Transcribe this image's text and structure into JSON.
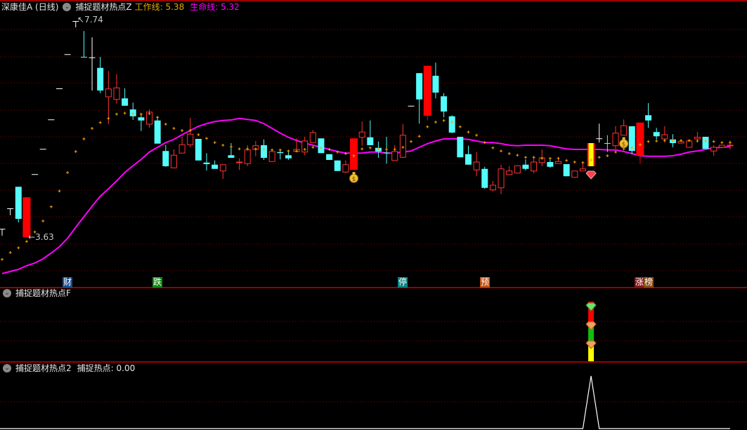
{
  "header": {
    "stock": "深康佳A (日线)",
    "indicator": "捕捉题材热点Z",
    "work_line_label": "工作线: 5.38",
    "life_line_label": "生命线: 5.32"
  },
  "panel2": {
    "title": "捕捉题材热点F"
  },
  "panel3": {
    "title": "捕捉题材热点2",
    "value_label": "捕捉热点: 0.00"
  },
  "annotations": {
    "high": "7.74",
    "low": "3.63",
    "high_arrow": "↖",
    "low_arrow": "←"
  },
  "signals": [
    {
      "text": "财",
      "color": "#1a4f8f"
    },
    {
      "text": "跌",
      "color": "#0f8a12"
    },
    {
      "text": "停",
      "color": "#0f8080"
    },
    {
      "text": "预",
      "color": "#c24f12"
    },
    {
      "text": "涨",
      "color": "#8a1414"
    },
    {
      "text": "榜",
      "color": "#8a4a14"
    }
  ],
  "colors": {
    "up": "#ff3232",
    "down": "#54fcfc",
    "flat": "#ffffff",
    "work_line": "#ffa500",
    "life_line": "#ff00ff",
    "grid": "#8b0000",
    "divider": "#d00000"
  },
  "icons": {
    "money_bag": "money-bag-icon",
    "diamond": "diamond-icon"
  },
  "chart_data": {
    "type": "candlestick",
    "title": "深康佳A (日线)",
    "ylim": [
      2.9,
      8.1
    ],
    "candles_ohlc": [
      [
        3.79,
        3.79,
        3.66,
        3.79
      ],
      [
        4.18,
        4.18,
        4.05,
        4.18
      ],
      [
        4.59,
        4.59,
        3.91,
        3.98
      ],
      [
        3.63,
        4.39,
        3.63,
        4.39
      ],
      [
        4.83,
        4.83,
        4.83,
        4.83
      ],
      [
        5.31,
        5.31,
        5.31,
        5.31
      ],
      [
        5.87,
        5.87,
        5.87,
        5.87
      ],
      [
        6.46,
        6.46,
        6.46,
        6.46
      ],
      [
        7.11,
        7.11,
        7.11,
        7.11
      ],
      [
        7.74,
        7.74,
        7.62,
        7.74
      ],
      [
        7.06,
        7.55,
        7.05,
        7.05
      ],
      [
        7.05,
        7.43,
        6.42,
        7.05
      ],
      [
        6.85,
        7.06,
        6.37,
        6.42
      ],
      [
        6.3,
        6.79,
        5.78,
        6.45
      ],
      [
        6.25,
        6.73,
        6.17,
        6.47
      ],
      [
        6.27,
        6.46,
        6.13,
        6.13
      ],
      [
        6.06,
        6.19,
        5.86,
        5.93
      ],
      [
        5.91,
        5.98,
        5.65,
        5.85
      ],
      [
        5.78,
        6.06,
        5.71,
        6.01
      ],
      [
        5.85,
        5.93,
        5.41,
        5.41
      ],
      [
        5.27,
        5.38,
        4.97,
        4.98
      ],
      [
        4.95,
        5.3,
        4.95,
        5.19
      ],
      [
        5.23,
        5.54,
        5.23,
        5.39
      ],
      [
        5.39,
        5.9,
        5.34,
        5.59
      ],
      [
        5.5,
        5.5,
        5.09,
        5.09
      ],
      [
        5.05,
        5.23,
        4.9,
        5.02
      ],
      [
        5.01,
        5.09,
        4.93,
        4.93
      ],
      [
        4.89,
        5.01,
        4.74,
        5.01
      ],
      [
        5.19,
        5.42,
        5.14,
        5.14
      ],
      [
        5.05,
        5.13,
        4.91,
        5.06
      ],
      [
        5.03,
        5.38,
        4.98,
        5.29
      ],
      [
        5.3,
        5.46,
        5.17,
        5.37
      ],
      [
        5.38,
        5.49,
        5.1,
        5.14
      ],
      [
        5.07,
        5.26,
        5.07,
        5.26
      ],
      [
        5.25,
        5.3,
        5.11,
        5.23
      ],
      [
        5.19,
        5.27,
        5.1,
        5.13
      ],
      [
        5.26,
        5.51,
        5.25,
        5.3
      ],
      [
        5.25,
        5.54,
        5.19,
        5.46
      ],
      [
        5.43,
        5.67,
        5.43,
        5.62
      ],
      [
        5.51,
        5.51,
        5.23,
        5.23
      ],
      [
        5.21,
        5.21,
        5.1,
        5.1
      ],
      [
        5.09,
        5.09,
        4.89,
        4.89
      ],
      [
        4.87,
        5.09,
        4.85,
        5.01
      ],
      [
        4.91,
        5.51,
        4.91,
        5.51
      ],
      [
        5.53,
        5.83,
        5.37,
        5.63
      ],
      [
        5.53,
        5.85,
        5.38,
        5.38
      ],
      [
        5.33,
        5.45,
        5.14,
        5.26
      ],
      [
        5.24,
        5.54,
        5.03,
        5.23
      ],
      [
        5.09,
        5.38,
        5.09,
        5.26
      ],
      [
        5.15,
        5.78,
        5.14,
        5.57
      ],
      [
        6.13,
        6.13,
        6.13,
        6.13
      ],
      [
        6.75,
        6.75,
        5.79,
        6.25
      ],
      [
        5.94,
        6.89,
        5.85,
        6.89
      ],
      [
        6.7,
        6.95,
        6.27,
        6.38
      ],
      [
        6.31,
        6.37,
        5.91,
        6.02
      ],
      [
        5.93,
        5.95,
        5.61,
        5.62
      ],
      [
        5.54,
        5.54,
        5.15,
        5.15
      ],
      [
        5.21,
        5.37,
        5.01,
        5.01
      ],
      [
        4.91,
        5.25,
        4.79,
        5.06
      ],
      [
        4.93,
        4.97,
        4.55,
        4.57
      ],
      [
        4.53,
        4.7,
        4.5,
        4.62
      ],
      [
        4.57,
        5.01,
        4.45,
        4.93
      ],
      [
        4.82,
        4.98,
        4.81,
        4.89
      ],
      [
        4.85,
        4.99,
        4.85,
        4.99
      ],
      [
        5.01,
        5.11,
        4.9,
        4.93
      ],
      [
        4.89,
        5.15,
        4.85,
        5.06
      ],
      [
        5.05,
        5.3,
        4.98,
        5.14
      ],
      [
        5.06,
        5.11,
        4.95,
        4.97
      ],
      [
        5.03,
        5.14,
        5.03,
        5.07
      ],
      [
        5.02,
        5.02,
        4.79,
        4.79
      ],
      [
        4.77,
        4.89,
        4.77,
        4.89
      ],
      [
        4.89,
        5.06,
        4.89,
        4.93
      ],
      [
        4.98,
        5.42,
        4.98,
        5.42
      ],
      [
        5.51,
        5.79,
        5.43,
        5.51
      ],
      [
        5.42,
        5.57,
        5.25,
        5.41
      ],
      [
        5.37,
        5.74,
        5.31,
        5.61
      ],
      [
        5.57,
        5.87,
        5.57,
        5.75
      ],
      [
        5.74,
        5.74,
        5.21,
        5.27
      ],
      [
        5.18,
        5.81,
        5.03,
        5.81
      ],
      [
        5.95,
        6.18,
        5.71,
        5.85
      ],
      [
        5.63,
        5.71,
        5.49,
        5.55
      ],
      [
        5.5,
        5.74,
        5.43,
        5.58
      ],
      [
        5.49,
        5.59,
        5.34,
        5.42
      ],
      [
        5.42,
        5.45,
        5.42,
        5.45
      ],
      [
        5.34,
        5.46,
        5.34,
        5.46
      ],
      [
        5.5,
        5.63,
        5.43,
        5.53
      ],
      [
        5.54,
        5.54,
        5.31,
        5.31
      ],
      [
        5.27,
        5.38,
        5.18,
        5.34
      ],
      [
        5.34,
        5.38,
        5.34,
        5.38
      ],
      [
        5.37,
        5.47,
        5.3,
        5.38
      ]
    ],
    "filled_up_indices": [
      3,
      43,
      52,
      78
    ],
    "highlight_index": 72,
    "work_line": [
      3.21,
      3.34,
      3.43,
      3.55,
      3.73,
      3.94,
      4.21,
      4.51,
      4.86,
      5.26,
      5.5,
      5.7,
      5.81,
      5.89,
      5.97,
      5.99,
      5.98,
      5.97,
      5.98,
      5.91,
      5.78,
      5.7,
      5.66,
      5.66,
      5.58,
      5.51,
      5.43,
      5.38,
      5.35,
      5.31,
      5.31,
      5.31,
      5.3,
      5.29,
      5.29,
      5.27,
      5.27,
      5.3,
      5.34,
      5.33,
      5.3,
      5.25,
      5.22,
      5.18,
      5.31,
      5.33,
      5.31,
      5.3,
      5.3,
      5.34,
      5.45,
      5.55,
      5.73,
      5.82,
      5.85,
      5.82,
      5.73,
      5.63,
      5.57,
      5.43,
      5.33,
      5.27,
      5.22,
      5.19,
      5.15,
      5.15,
      5.13,
      5.13,
      5.13,
      5.09,
      5.06,
      5.05,
      5.1,
      5.15,
      5.18,
      5.25,
      5.31,
      5.33,
      5.39,
      5.45,
      5.46,
      5.47,
      5.47,
      5.47,
      5.47,
      5.46,
      5.46,
      5.45,
      5.43,
      5.43
    ],
    "life_line": [
      2.94,
      2.98,
      3.02,
      3.09,
      3.14,
      3.22,
      3.33,
      3.45,
      3.61,
      3.82,
      4.02,
      4.22,
      4.41,
      4.55,
      4.7,
      4.86,
      4.99,
      5.11,
      5.25,
      5.34,
      5.43,
      5.49,
      5.58,
      5.66,
      5.74,
      5.79,
      5.83,
      5.85,
      5.86,
      5.89,
      5.87,
      5.85,
      5.79,
      5.7,
      5.61,
      5.53,
      5.47,
      5.42,
      5.38,
      5.34,
      5.3,
      5.26,
      5.23,
      5.23,
      5.23,
      5.25,
      5.25,
      5.23,
      5.23,
      5.25,
      5.27,
      5.34,
      5.41,
      5.46,
      5.5,
      5.5,
      5.5,
      5.49,
      5.46,
      5.43,
      5.43,
      5.41,
      5.38,
      5.37,
      5.38,
      5.38,
      5.38,
      5.37,
      5.34,
      5.31,
      5.3,
      5.3,
      5.3,
      5.3,
      5.29,
      5.29,
      5.26,
      5.22,
      5.18,
      5.17,
      5.17,
      5.17,
      5.18,
      5.21,
      5.25,
      5.27,
      5.3,
      5.33,
      5.34,
      5.35
    ],
    "money_bag_indices": [
      43,
      76
    ],
    "diamond_index": 72,
    "signal_indices": [
      8,
      19,
      49,
      59,
      77,
      78
    ],
    "panel2_signal": {
      "index": 72,
      "segments": [
        {
          "color": "#ff0000",
          "value": 1
        },
        {
          "color": "#10c010",
          "value": 1
        },
        {
          "color": "#ffff00",
          "value": 1
        }
      ]
    },
    "panel3_series": {
      "peak_index": 72,
      "peak_value": 1,
      "baseline": 0
    }
  }
}
